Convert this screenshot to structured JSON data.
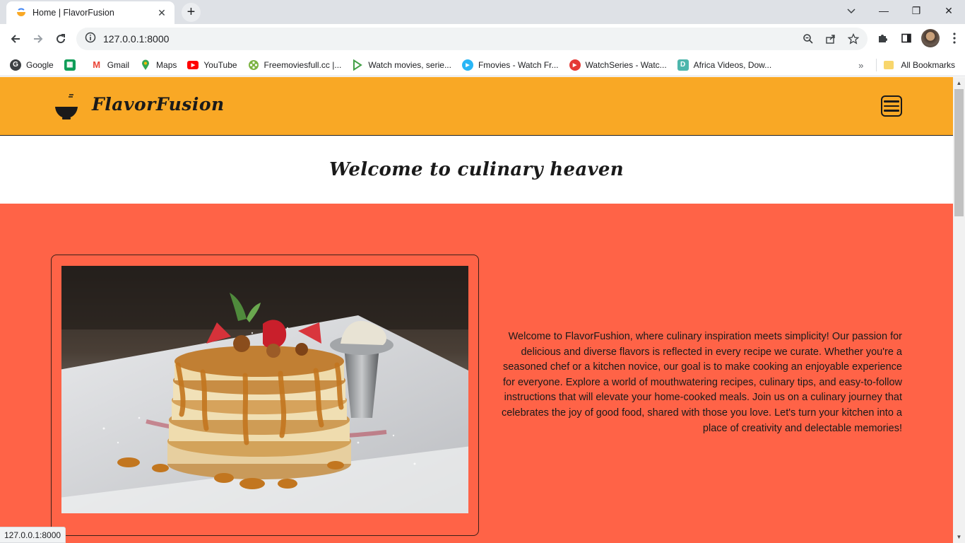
{
  "browser": {
    "tab": {
      "title": "Home | FlavorFusion"
    },
    "address": {
      "url": "127.0.0.1:8000"
    },
    "bookmarks": [
      {
        "label": "Google",
        "icon": "google-icon"
      },
      {
        "label": "",
        "icon": "sheets-icon"
      },
      {
        "label": "Gmail",
        "icon": "gmail-icon"
      },
      {
        "label": "Maps",
        "icon": "maps-icon"
      },
      {
        "label": "YouTube",
        "icon": "youtube-icon"
      },
      {
        "label": "Freemoviesfull.cc |...",
        "icon": "film-reel-icon"
      },
      {
        "label": "Watch movies, serie...",
        "icon": "play-outline-icon"
      },
      {
        "label": "Fmovies - Watch Fr...",
        "icon": "play-circle-icon"
      },
      {
        "label": "WatchSeries - Watc...",
        "icon": "play-red-icon"
      },
      {
        "label": "Africa Videos, Dow...",
        "icon": "d-badge-icon"
      }
    ],
    "all_bookmarks": "All Bookmarks",
    "status_url": "127.0.0.1:8000"
  },
  "site": {
    "brand": "FlavorFusion",
    "headline": "Welcome to culinary heaven",
    "about": "Welcome to FlavorFushion, where culinary inspiration meets simplicity! Our passion for delicious and diverse flavors is reflected in every recipe we curate. Whether you're a seasoned chef or a kitchen novice, our goal is to make cooking an enjoyable experience for everyone. Explore a world of mouthwatering recipes, culinary tips, and easy-to-follow instructions that will elevate your home-cooked meals. Join us on a culinary journey that celebrates the joy of good food, shared with those you love. Let's turn your kitchen into a place of creativity and delectable memories!",
    "hero_image": "pancake-stack-photo"
  },
  "colors": {
    "header_bg": "#f9a825",
    "hero_bg": "#ff6347",
    "text": "#1a1a1a"
  }
}
